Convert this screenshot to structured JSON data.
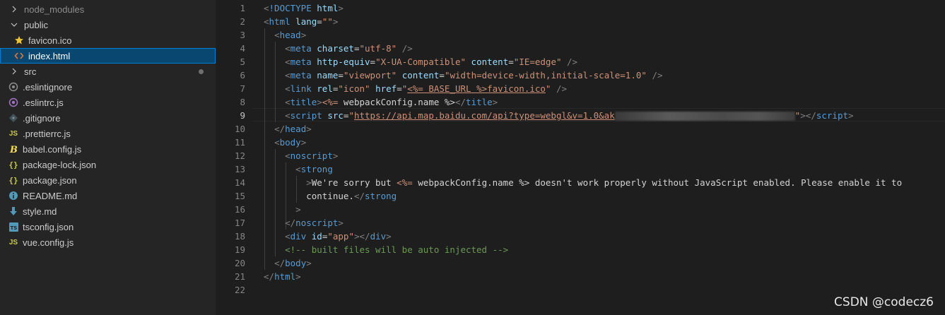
{
  "explorer": {
    "items": [
      {
        "label": "node_modules",
        "kind": "folder",
        "expanded": false,
        "icon": "chevron-right-icon"
      },
      {
        "label": "public",
        "kind": "folder",
        "expanded": true,
        "icon": "chevron-down-icon"
      },
      {
        "label": "favicon.ico",
        "kind": "file",
        "icon": "star-icon"
      },
      {
        "label": "index.html",
        "kind": "file",
        "icon": "html-code-icon",
        "selected": true
      },
      {
        "label": "src",
        "kind": "folder",
        "expanded": false,
        "icon": "chevron-right-icon"
      },
      {
        "label": ".eslintignore",
        "kind": "file",
        "icon": "eslint-ignore-icon"
      },
      {
        "label": ".eslintrc.js",
        "kind": "file",
        "icon": "eslint-icon"
      },
      {
        "label": ".gitignore",
        "kind": "file",
        "icon": "git-icon"
      },
      {
        "label": ".prettierrc.js",
        "kind": "file",
        "icon": "js-icon",
        "glyph": "JS"
      },
      {
        "label": "babel.config.js",
        "kind": "file",
        "icon": "babel-icon"
      },
      {
        "label": "package-lock.json",
        "kind": "file",
        "icon": "json-icon",
        "glyph": "{}"
      },
      {
        "label": "package.json",
        "kind": "file",
        "icon": "json-icon",
        "glyph": "{}"
      },
      {
        "label": "README.md",
        "kind": "file",
        "icon": "info-icon"
      },
      {
        "label": "style.md",
        "kind": "file",
        "icon": "markdown-arrow-icon"
      },
      {
        "label": "tsconfig.json",
        "kind": "file",
        "icon": "typescript-icon",
        "glyph": "TS"
      },
      {
        "label": "vue.config.js",
        "kind": "file",
        "icon": "js-icon",
        "glyph": "JS"
      }
    ]
  },
  "editor": {
    "active_line": 9,
    "line_numbers": [
      "1",
      "2",
      "3",
      "4",
      "5",
      "6",
      "7",
      "8",
      "9",
      "10",
      "11",
      "12",
      "13",
      "14",
      "15",
      "16",
      "17",
      "18",
      "19",
      "20",
      "21",
      "22"
    ],
    "lines": [
      [
        [
          "p",
          "<"
        ],
        [
          "t",
          "!DOCTYPE"
        ],
        [
          "tx",
          " "
        ],
        [
          "a",
          "html"
        ],
        [
          "p",
          ">"
        ]
      ],
      [
        [
          "p",
          "<"
        ],
        [
          "t",
          "html"
        ],
        [
          "tx",
          " "
        ],
        [
          "a",
          "lang"
        ],
        [
          "tx",
          "="
        ],
        [
          "s",
          "\"\""
        ],
        [
          "p",
          ">"
        ]
      ],
      [
        [
          "tx",
          "  "
        ],
        [
          "p",
          "<"
        ],
        [
          "t",
          "head"
        ],
        [
          "p",
          ">"
        ]
      ],
      [
        [
          "tx",
          "    "
        ],
        [
          "p",
          "<"
        ],
        [
          "t",
          "meta"
        ],
        [
          "tx",
          " "
        ],
        [
          "a",
          "charset"
        ],
        [
          "tx",
          "="
        ],
        [
          "s",
          "\"utf-8\""
        ],
        [
          "tx",
          " "
        ],
        [
          "p",
          "/>"
        ]
      ],
      [
        [
          "tx",
          "    "
        ],
        [
          "p",
          "<"
        ],
        [
          "t",
          "meta"
        ],
        [
          "tx",
          " "
        ],
        [
          "a",
          "http-equiv"
        ],
        [
          "tx",
          "="
        ],
        [
          "s",
          "\"X-UA-Compatible\""
        ],
        [
          "tx",
          " "
        ],
        [
          "a",
          "content"
        ],
        [
          "tx",
          "="
        ],
        [
          "s",
          "\"IE=edge\""
        ],
        [
          "tx",
          " "
        ],
        [
          "p",
          "/>"
        ]
      ],
      [
        [
          "tx",
          "    "
        ],
        [
          "p",
          "<"
        ],
        [
          "t",
          "meta"
        ],
        [
          "tx",
          " "
        ],
        [
          "a",
          "name"
        ],
        [
          "tx",
          "="
        ],
        [
          "s",
          "\"viewport\""
        ],
        [
          "tx",
          " "
        ],
        [
          "a",
          "content"
        ],
        [
          "tx",
          "="
        ],
        [
          "s",
          "\"width=device-width,initial-scale=1.0\""
        ],
        [
          "tx",
          " "
        ],
        [
          "p",
          "/>"
        ]
      ],
      [
        [
          "tx",
          "    "
        ],
        [
          "p",
          "<"
        ],
        [
          "t",
          "link"
        ],
        [
          "tx",
          " "
        ],
        [
          "a",
          "rel"
        ],
        [
          "tx",
          "="
        ],
        [
          "s",
          "\"icon\""
        ],
        [
          "tx",
          " "
        ],
        [
          "a",
          "href"
        ],
        [
          "tx",
          "="
        ],
        [
          "s",
          "\""
        ],
        [
          "su",
          "<%= BASE_URL %>favicon.ico"
        ],
        [
          "s",
          "\""
        ],
        [
          "tx",
          " "
        ],
        [
          "p",
          "/>"
        ]
      ],
      [
        [
          "tx",
          "    "
        ],
        [
          "p",
          "<"
        ],
        [
          "t",
          "title"
        ],
        [
          "p",
          ">"
        ],
        [
          "s",
          "<%="
        ],
        [
          "tx",
          " webpackConfig.name %>"
        ],
        [
          "p",
          "</"
        ],
        [
          "t",
          "title"
        ],
        [
          "p",
          ">"
        ]
      ],
      [
        [
          "tx",
          "    "
        ],
        [
          "p",
          "<"
        ],
        [
          "t",
          "script"
        ],
        [
          "tx",
          " "
        ],
        [
          "a",
          "src"
        ],
        [
          "tx",
          "="
        ],
        [
          "s",
          "\""
        ],
        [
          "su",
          "https://api.map.baidu.com/api?type=webgl&v=1.0&ak"
        ],
        [
          "r",
          ""
        ],
        [
          "s",
          "\""
        ],
        [
          "p",
          "></"
        ],
        [
          "t",
          "script"
        ],
        [
          "p",
          ">"
        ]
      ],
      [
        [
          "tx",
          "  "
        ],
        [
          "p",
          "</"
        ],
        [
          "t",
          "head"
        ],
        [
          "p",
          ">"
        ]
      ],
      [
        [
          "tx",
          "  "
        ],
        [
          "p",
          "<"
        ],
        [
          "t",
          "body"
        ],
        [
          "p",
          ">"
        ]
      ],
      [
        [
          "tx",
          "    "
        ],
        [
          "p",
          "<"
        ],
        [
          "t",
          "noscript"
        ],
        [
          "p",
          ">"
        ]
      ],
      [
        [
          "tx",
          "      "
        ],
        [
          "p",
          "<"
        ],
        [
          "t",
          "strong"
        ]
      ],
      [
        [
          "tx",
          "        "
        ],
        [
          "p",
          ">"
        ],
        [
          "tx",
          "We're sorry but "
        ],
        [
          "s",
          "<%="
        ],
        [
          "tx",
          " webpackConfig.name %> doesn't work properly without JavaScript enabled. Please enable it to"
        ]
      ],
      [
        [
          "tx",
          "        continue."
        ],
        [
          "p",
          "</"
        ],
        [
          "t",
          "strong"
        ]
      ],
      [
        [
          "tx",
          "      "
        ],
        [
          "p",
          ">"
        ]
      ],
      [
        [
          "tx",
          "    "
        ],
        [
          "p",
          "</"
        ],
        [
          "t",
          "noscript"
        ],
        [
          "p",
          ">"
        ]
      ],
      [
        [
          "tx",
          "    "
        ],
        [
          "p",
          "<"
        ],
        [
          "t",
          "div"
        ],
        [
          "tx",
          " "
        ],
        [
          "a",
          "id"
        ],
        [
          "tx",
          "="
        ],
        [
          "s",
          "\"app\""
        ],
        [
          "p",
          "></"
        ],
        [
          "t",
          "div"
        ],
        [
          "p",
          ">"
        ]
      ],
      [
        [
          "tx",
          "    "
        ],
        [
          "c",
          "<!-- built files will be auto injected -->"
        ]
      ],
      [
        [
          "tx",
          "  "
        ],
        [
          "p",
          "</"
        ],
        [
          "t",
          "body"
        ],
        [
          "p",
          ">"
        ]
      ],
      [
        [
          "p",
          "</"
        ],
        [
          "t",
          "html"
        ],
        [
          "p",
          ">"
        ]
      ],
      [
        [
          "tx",
          ""
        ]
      ]
    ]
  },
  "watermark": "CSDN @codecz6",
  "colors": {
    "background": "#1e1e1e",
    "sidebar": "#252526",
    "selection": "#094771",
    "tag": "#569cd6",
    "attribute": "#9cdcfe",
    "string": "#ce9178",
    "comment": "#6a9955"
  }
}
